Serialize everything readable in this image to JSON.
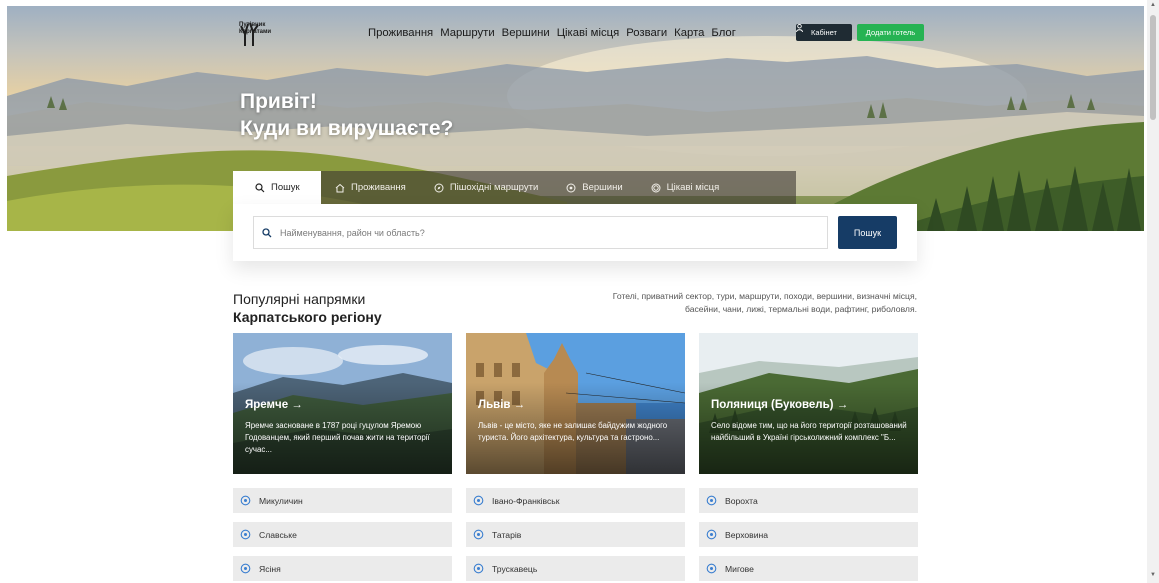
{
  "header": {
    "logo_line1": "Путівник",
    "logo_line2": "Карпатами",
    "nav": [
      "Проживання",
      "Маршрути",
      "Вершини",
      "Цікаві місця",
      "Розваги",
      "Карта",
      "Блог"
    ],
    "cabinet_label": "Кабінет",
    "add_hotel_label": "Додати готель"
  },
  "hero": {
    "title_line1": "Привіт!",
    "title_line2": "Куди ви вирушаєте?"
  },
  "search": {
    "tabs": [
      {
        "label": "Пошук",
        "icon": "search-icon"
      },
      {
        "label": "Проживання",
        "icon": "home-icon"
      },
      {
        "label": "Пішохідні маршрути",
        "icon": "compass-icon"
      },
      {
        "label": "Вершини",
        "icon": "pin-icon"
      },
      {
        "label": "Цікаві місця",
        "icon": "target-icon"
      }
    ],
    "placeholder": "Найменування, район чи область?",
    "button_label": "Пошук"
  },
  "popular": {
    "title_line1": "Популярні напрямки",
    "title_line2": "Карпатського регіону",
    "description": "Готелі, приватний сектор, тури, маршрути, походи, вершини, визначні місця, басейни, чани, лижі, термальні води, рафтинг, риболовля."
  },
  "cards": [
    {
      "title": "Яремче →",
      "text": "Яремче засноване в 1787 році гуцулом Яремою Годованцем, який перший почав жити на території сучас..."
    },
    {
      "title": "Львів →",
      "text": "Львів - це місто, яке не залишає байдужим жодного туриста. Його архітектура, культура та гастроно..."
    },
    {
      "title": "Поляниця (Буковель) →",
      "text": "Село відоме тим, що на його території розташований найбільший в Україні гірськолижний комплекс \"Б..."
    }
  ],
  "locations": [
    [
      "Микуличин",
      "Славське",
      "Ясіня"
    ],
    [
      "Івано-Франківськ",
      "Татарів",
      "Трускавець"
    ],
    [
      "Ворохта",
      "Верховина",
      "Мигове"
    ]
  ],
  "colors": {
    "nav_dark": "#1f2b33",
    "accent_green": "#26b353",
    "search_button": "#163c66"
  }
}
